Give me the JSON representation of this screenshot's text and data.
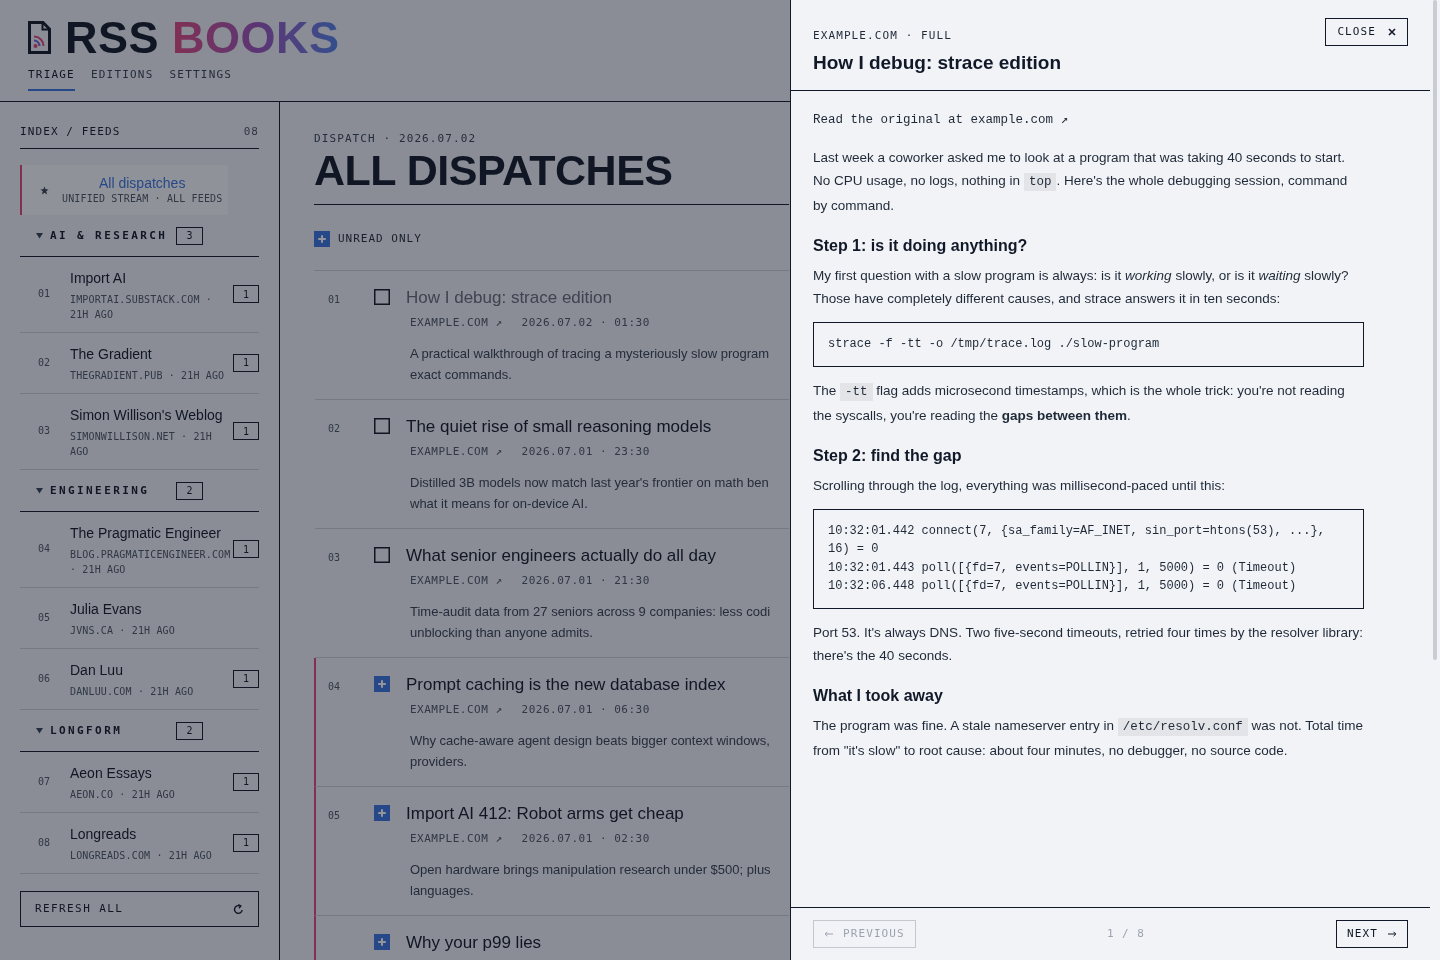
{
  "header": {
    "brand": {
      "name": "RSS",
      "accent": "BOOKS"
    },
    "tabs": [
      {
        "label": "TRIAGE",
        "selected": true
      },
      {
        "label": "EDITIONS",
        "selected": false
      },
      {
        "label": "SETTINGS",
        "selected": false
      }
    ]
  },
  "sidebar": {
    "title": "INDEX / FEEDS",
    "count": "08",
    "all_feeds": {
      "title": "All dispatches",
      "subtitle": "UNIFIED STREAM · ALL FEEDS",
      "selected": true
    },
    "groups": [
      {
        "name": "AI & RESEARCH",
        "count": "3",
        "expanded": true,
        "feeds": [
          {
            "number": "01",
            "title": "Import AI",
            "meta": "IMPORTAI.SUBSTACK.COM · 21H AGO",
            "badge": "1",
            "selected": false
          },
          {
            "number": "02",
            "title": "The Gradient",
            "meta": "THEGRADIENT.PUB · 21H AGO",
            "badge": "1",
            "selected": false
          },
          {
            "number": "03",
            "title": "Simon Willison's Weblog",
            "meta": "SIMONWILLISON.NET · 21H AGO",
            "badge": "1",
            "selected": false
          }
        ]
      },
      {
        "name": "ENGINEERING",
        "count": "2",
        "expanded": true,
        "feeds": [
          {
            "number": "04",
            "title": "The Pragmatic Engineer",
            "meta": "BLOG.PRAGMATICENGINEER.COM · 21H AGO",
            "badge": "1",
            "selected": false
          },
          {
            "number": "05",
            "title": "Julia Evans",
            "meta": "JVNS.CA · 21H AGO",
            "selected": false
          },
          {
            "number": "06",
            "title": "Dan Luu",
            "meta": "DANLUU.COM · 21H AGO",
            "badge": "1",
            "selected": false
          }
        ]
      },
      {
        "name": "LONGFORM",
        "count": "2",
        "expanded": true,
        "feeds": [
          {
            "number": "07",
            "title": "Aeon Essays",
            "meta": "AEON.CO · 21H AGO",
            "badge": "1",
            "selected": false
          },
          {
            "number": "08",
            "title": "Longreads",
            "meta": "LONGREADS.COM · 21H AGO",
            "badge": "1",
            "selected": false
          }
        ]
      }
    ],
    "refresh": {
      "label": "REFRESH ALL"
    }
  },
  "main": {
    "kicker": "DISPATCH · 2026.07.02",
    "title": "ALL DISPATCHES",
    "filter": {
      "label": "UNREAD ONLY",
      "checked": true
    },
    "items": [
      {
        "number": "01",
        "title": "How I debug: strace edition",
        "source": "EXAMPLE.COM ↗",
        "time": "2026.07.02 · 01:30",
        "summary_lines": [
          "A practical walkthrough of tracing a mysteriously slow program",
          "exact commands."
        ],
        "checked": false,
        "unread": false,
        "selected": true
      },
      {
        "number": "02",
        "title": "The quiet rise of small reasoning models",
        "source": "EXAMPLE.COM ↗",
        "time": "2026.07.01 · 23:30",
        "summary_lines": [
          "Distilled 3B models now match last year's frontier on math ben",
          "what it means for on-device AI."
        ],
        "checked": false,
        "unread": false,
        "selected": false
      },
      {
        "number": "03",
        "title": "What senior engineers actually do all day",
        "source": "EXAMPLE.COM ↗",
        "time": "2026.07.01 · 21:30",
        "summary_lines": [
          "Time-audit data from 27 seniors across 9 companies: less codi",
          "unblocking than anyone admits."
        ],
        "checked": false,
        "unread": false,
        "selected": false
      },
      {
        "number": "04",
        "title": "Prompt caching is the new database index",
        "source": "EXAMPLE.COM ↗",
        "time": "2026.07.01 · 06:30",
        "summary_lines": [
          "Why cache-aware agent design beats bigger context windows,",
          "providers."
        ],
        "checked": true,
        "unread": true,
        "selected": false
      },
      {
        "number": "05",
        "title": "Import AI 412: Robot arms get cheap",
        "source": "EXAMPLE.COM ↗",
        "time": "2026.07.01 · 02:30",
        "summary_lines": [
          "Open hardware brings manipulation research under $500; plus",
          "languages."
        ],
        "checked": true,
        "unread": true,
        "selected": false
      },
      {
        "title": "Why your p99 lies",
        "checked": true,
        "unread": true,
        "selected": false
      }
    ]
  },
  "drawer": {
    "kicker": "EXAMPLE.COM · FULL",
    "title": "How I debug: strace edition",
    "close": {
      "label": "CLOSE"
    },
    "original_link": "Read the original at example.com ↗",
    "blocks": [
      {
        "kind": "paragraph",
        "segments": [
          {
            "kind": "text",
            "text": "Last week a coworker asked me to look at a program that was taking 40 seconds to start. No CPU usage, no logs, nothing in "
          },
          {
            "kind": "code",
            "text": "top"
          },
          {
            "kind": "text",
            "text": ". Here's the whole debugging session, command by command."
          }
        ]
      },
      {
        "kind": "heading",
        "text": "Step 1: is it doing anything?"
      },
      {
        "kind": "paragraph",
        "segments": [
          {
            "kind": "text",
            "text": "My first question with a slow program is always: is it *working* slowly, or is it *waiting* slowly? Those have completely different causes, and strace answers it in ten seconds:"
          }
        ]
      },
      {
        "kind": "code_block",
        "lines": [
          "strace -f -tt -o /tmp/trace.log ./slow-program"
        ]
      },
      {
        "kind": "paragraph",
        "segments": [
          {
            "kind": "text",
            "text": "The "
          },
          {
            "kind": "code",
            "text": "-tt"
          },
          {
            "kind": "text",
            "text": " flag adds microsecond timestamps, which is the whole trick: you're not reading the syscalls, you're reading the **gaps between them**."
          }
        ]
      },
      {
        "kind": "heading",
        "text": "Step 2: find the gap"
      },
      {
        "kind": "paragraph",
        "segments": [
          {
            "kind": "text",
            "text": "Scrolling through the log, everything was millisecond-paced until this:"
          }
        ]
      },
      {
        "kind": "code_block",
        "lines": [
          "10:32:01.442 connect(7, {sa_family=AF_INET, sin_port=htons(53), ...}, 16) = 0",
          "10:32:01.443 poll([{fd=7, events=POLLIN}], 1, 5000) = 0 (Timeout)",
          "10:32:06.448 poll([{fd=7, events=POLLIN}], 1, 5000) = 0 (Timeout)"
        ]
      },
      {
        "kind": "paragraph",
        "segments": [
          {
            "kind": "text",
            "text": "Port 53. It's always DNS. Two five-second timeouts, retried four times by the resolver library: there's the 40 seconds."
          }
        ]
      },
      {
        "kind": "heading",
        "text": "What I took away"
      },
      {
        "kind": "paragraph",
        "segments": [
          {
            "kind": "text",
            "text": "The program was fine. A stale nameserver entry in "
          },
          {
            "kind": "code",
            "text": "/etc/resolv.conf"
          },
          {
            "kind": "text",
            "text": " was not. Total time from \"it's slow\" to root cause: about four minutes, no debugger, no source code."
          }
        ]
      }
    ],
    "footer": {
      "previous": {
        "label": "PREVIOUS",
        "disabled": true
      },
      "position": "1 / 8",
      "next": {
        "label": "NEXT",
        "disabled": false
      }
    }
  }
}
